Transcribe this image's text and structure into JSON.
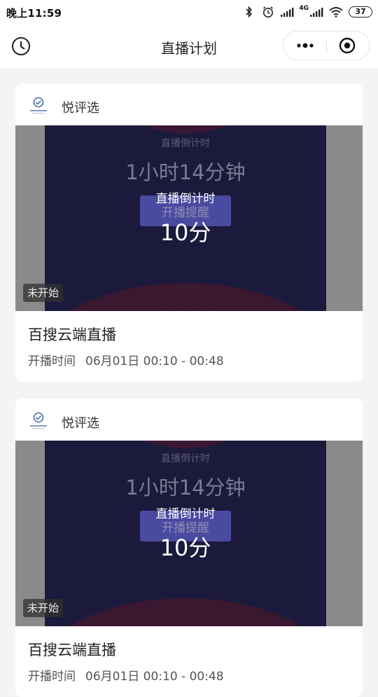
{
  "status_bar": {
    "time": "晚上11:59",
    "battery": "37",
    "network": "4G"
  },
  "nav": {
    "title": "直播计划",
    "back_icon": "clock-history-icon",
    "more_icon": "more-dots-icon",
    "close_icon": "target-close-icon"
  },
  "cards": [
    {
      "shop_name": "悦评选",
      "poster_faint_top": "直播倒计时",
      "poster_faint_big": "1小时14分钟",
      "poster_faint_button": "开播提醒",
      "countdown_label": "直播倒计时",
      "countdown_value": "10分",
      "status": "未开始",
      "title": "百搜云端直播",
      "time_label": "开播时间",
      "time_value": "06月01日 00:10 - 00:48"
    },
    {
      "shop_name": "悦评选",
      "poster_faint_top": "直播倒计时",
      "poster_faint_big": "1小时14分钟",
      "poster_faint_button": "开播提醒",
      "countdown_label": "直播倒计时",
      "countdown_value": "10分",
      "status": "未开始",
      "title": "百搜云端直播",
      "time_label": "开播时间",
      "time_value": "06月01日 00:10 - 00:48"
    }
  ],
  "colors": {
    "poster_bg": "#1b1a3d",
    "poster_accent": "#3a1830",
    "card_bg": "#ffffff",
    "page_bg": "#f4f4f4"
  }
}
